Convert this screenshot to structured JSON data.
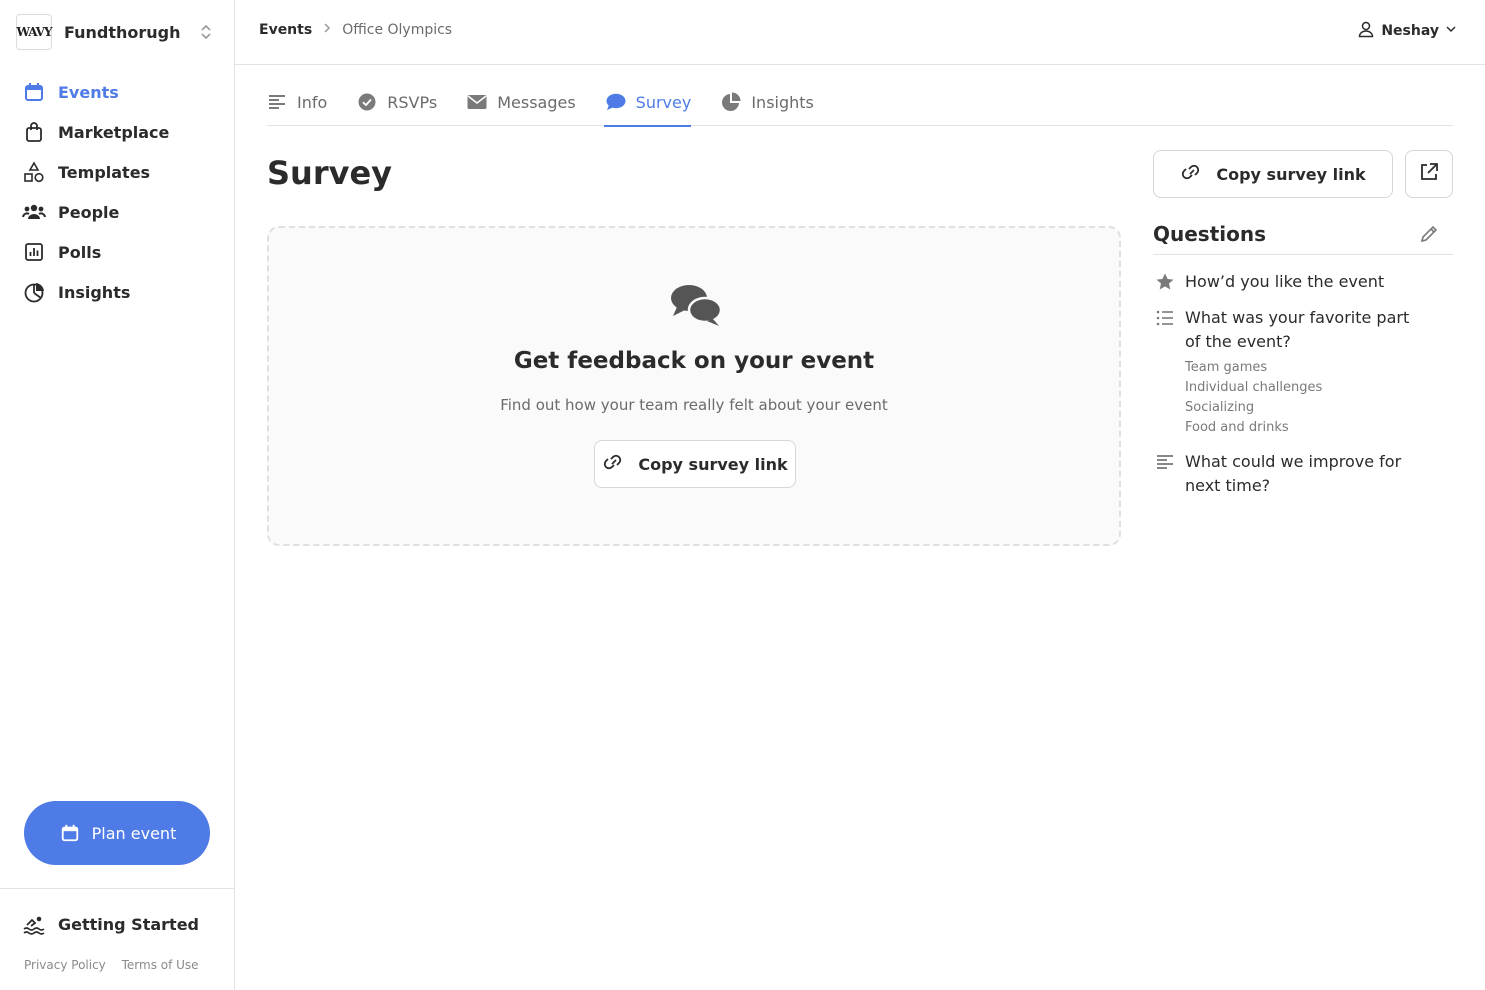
{
  "org": {
    "logo_text": "WAVY",
    "name": "Fundthorugh"
  },
  "sidebar": {
    "items": [
      {
        "label": "Events",
        "icon": "calendar-icon",
        "active": true
      },
      {
        "label": "Marketplace",
        "icon": "shopping-bag-icon"
      },
      {
        "label": "Templates",
        "icon": "shapes-icon"
      },
      {
        "label": "People",
        "icon": "people-icon"
      },
      {
        "label": "Polls",
        "icon": "bar-chart-icon"
      },
      {
        "label": "Insights",
        "icon": "pie-chart-icon"
      }
    ],
    "plan_button": "Plan event",
    "getting_started": "Getting Started",
    "privacy": "Privacy Policy",
    "terms": "Terms of Use"
  },
  "breadcrumb": {
    "root": "Events",
    "current": "Office Olympics"
  },
  "user": {
    "name": "Neshay"
  },
  "tabs": [
    {
      "label": "Info",
      "icon": "text-lines-icon"
    },
    {
      "label": "RSVPs",
      "icon": "check-circle-icon"
    },
    {
      "label": "Messages",
      "icon": "envelope-icon"
    },
    {
      "label": "Survey",
      "icon": "chat-bubble-icon",
      "active": true
    },
    {
      "label": "Insights",
      "icon": "pie-chart-icon"
    }
  ],
  "main": {
    "title": "Survey",
    "empty_state": {
      "title": "Get feedback on your event",
      "subtitle": "Find out how your team really felt about your event",
      "button": "Copy survey link"
    }
  },
  "panel": {
    "copy_link": "Copy survey link",
    "questions_title": "Questions",
    "questions": [
      {
        "text": "How’d you like the event",
        "icon": "star-icon",
        "options": []
      },
      {
        "text": "What was your favorite part of the event?",
        "icon": "list-icon",
        "options": [
          "Team games",
          "Individual challenges",
          "Socializing",
          "Food and drinks"
        ]
      },
      {
        "text": "What could we improve for next time?",
        "icon": "text-lines-icon",
        "options": []
      }
    ]
  },
  "colors": {
    "accent": "#4f7be6",
    "text": "#2b2b2b",
    "muted": "#6b6b6b"
  }
}
